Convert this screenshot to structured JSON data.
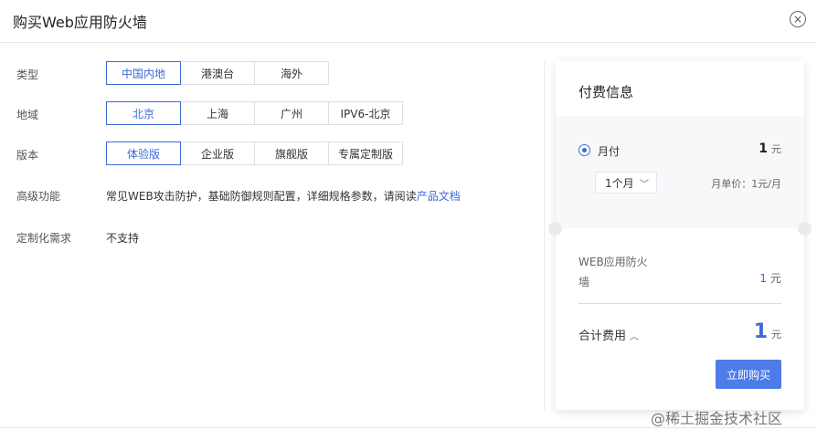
{
  "dialog": {
    "title": "购买Web应用防火墙",
    "close_icon": "×"
  },
  "rows": {
    "type": {
      "label": "类型",
      "options": [
        "中国内地",
        "港澳台",
        "海外"
      ],
      "selected": "中国内地"
    },
    "region": {
      "label": "地域",
      "options": [
        "北京",
        "上海",
        "广州",
        "IPV6-北京"
      ],
      "selected": "北京"
    },
    "edition": {
      "label": "版本",
      "options": [
        "体验版",
        "企业版",
        "旗舰版",
        "专属定制版"
      ],
      "selected": "体验版"
    },
    "advanced": {
      "label": "高级功能",
      "text": "常见WEB攻击防护，基础防御规则配置，详细规格参数，请阅读",
      "link": "产品文档"
    },
    "custom": {
      "label": "定制化需求",
      "value": "不支持"
    }
  },
  "payment": {
    "title": "付费信息",
    "mode_label": "月付",
    "mode_value": "1",
    "currency": "元",
    "duration": "1个月",
    "unit_price": "月单价：1元/月",
    "product_name": "WEB应用防火墙",
    "product_price": "1",
    "total_label": "合计费用",
    "total_value": "1",
    "buy_label": "立即购买"
  },
  "watermark": "@稀土掘金技术社区",
  "colors": {
    "accent": "#3d6bd6",
    "button": "#4d7be8"
  }
}
